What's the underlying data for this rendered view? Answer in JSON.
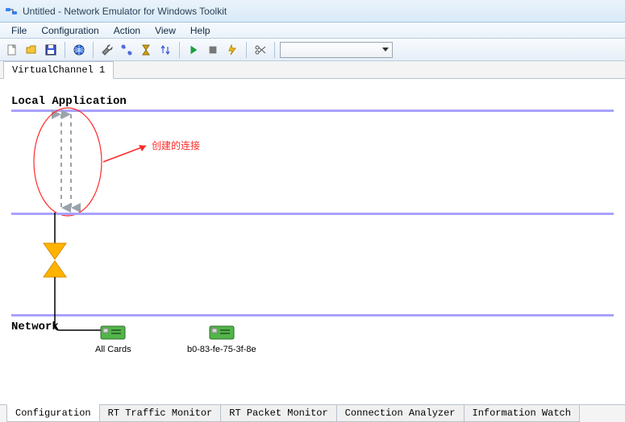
{
  "window": {
    "title": "Untitled - Network Emulator for Windows Toolkit"
  },
  "menu": {
    "items": [
      "File",
      "Configuration",
      "Action",
      "View",
      "Help"
    ]
  },
  "toolbar": {
    "icons": [
      "new-file",
      "open-file",
      "save-file",
      "globe",
      "wrench",
      "link-filter",
      "hourglass",
      "arrows-updown",
      "play",
      "stop",
      "bolt",
      "scissors"
    ]
  },
  "topTabs": {
    "active": "VirtualChannel 1"
  },
  "canvas": {
    "localApp": "Local Application",
    "network": "Network",
    "annotation": "创建的连接",
    "nics": [
      {
        "label": "All Cards"
      },
      {
        "label": "b0-83-fe-75-3f-8e"
      }
    ]
  },
  "bottomTabs": [
    "Configuration",
    "RT Traffic Monitor",
    "RT Packet Monitor",
    "Connection Analyzer",
    "Information Watch"
  ]
}
